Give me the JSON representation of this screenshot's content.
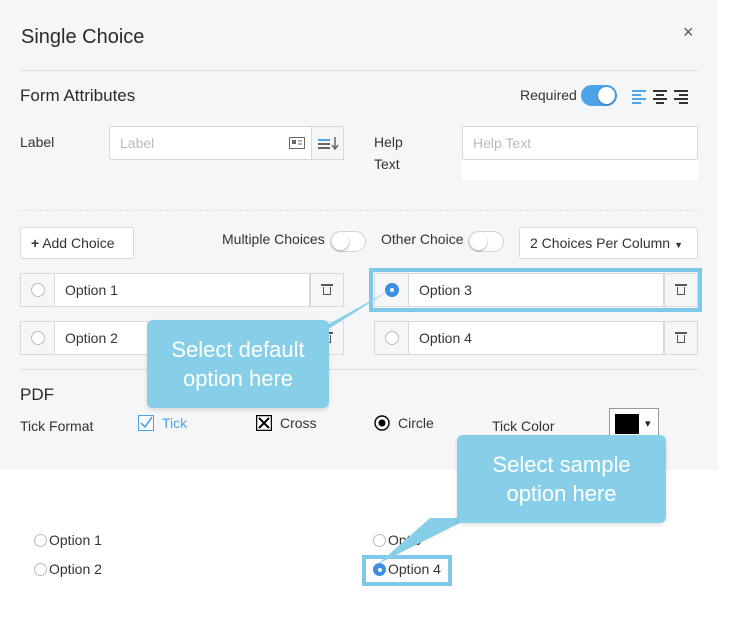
{
  "modal": {
    "title": "Single Choice",
    "close_symbol": "×"
  },
  "form_attributes": {
    "title": "Form Attributes",
    "required_label": "Required",
    "required_on": true,
    "align_icons": [
      "align-left-icon",
      "align-center-icon",
      "align-right-icon"
    ],
    "label_field_label": "Label",
    "label_placeholder": "Label",
    "help_label_line1": "Help",
    "help_label_line2": "Text",
    "help_placeholder": "Help Text"
  },
  "choices_toolbar": {
    "add_choice": "Add Choice",
    "multiple_choices_label": "Multiple Choices",
    "multiple_choices_on": false,
    "other_choice_label": "Other Choice",
    "other_choice_on": false,
    "per_column": "2 Choices Per Column"
  },
  "choices": [
    {
      "label": "Option 1",
      "checked": false
    },
    {
      "label": "Option 3",
      "checked": true
    },
    {
      "label": "Option 2",
      "checked": false
    },
    {
      "label": "Option 4",
      "checked": false
    }
  ],
  "pdf": {
    "title": "PDF",
    "tick_format_label": "Tick Format",
    "tick": "Tick",
    "cross": "Cross",
    "circle": "Circle",
    "tick_color_label": "Tick Color",
    "tick_color": "#000000",
    "dropdown_arrow": "▾"
  },
  "callouts": {
    "default_line1": "Select default",
    "default_line2": "option here",
    "sample_line1": "Select sample",
    "sample_line2": "option here"
  },
  "preview": {
    "items": [
      {
        "label": "Option 1",
        "checked": false
      },
      {
        "label": "Option 2",
        "checked": false
      },
      {
        "label": "Optio",
        "checked": false
      },
      {
        "label": "Option 4",
        "checked": true
      }
    ]
  },
  "colors": {
    "accent": "#3d8fe0",
    "callout": "#87cfe9",
    "tick_blue": "#4da3e8"
  }
}
